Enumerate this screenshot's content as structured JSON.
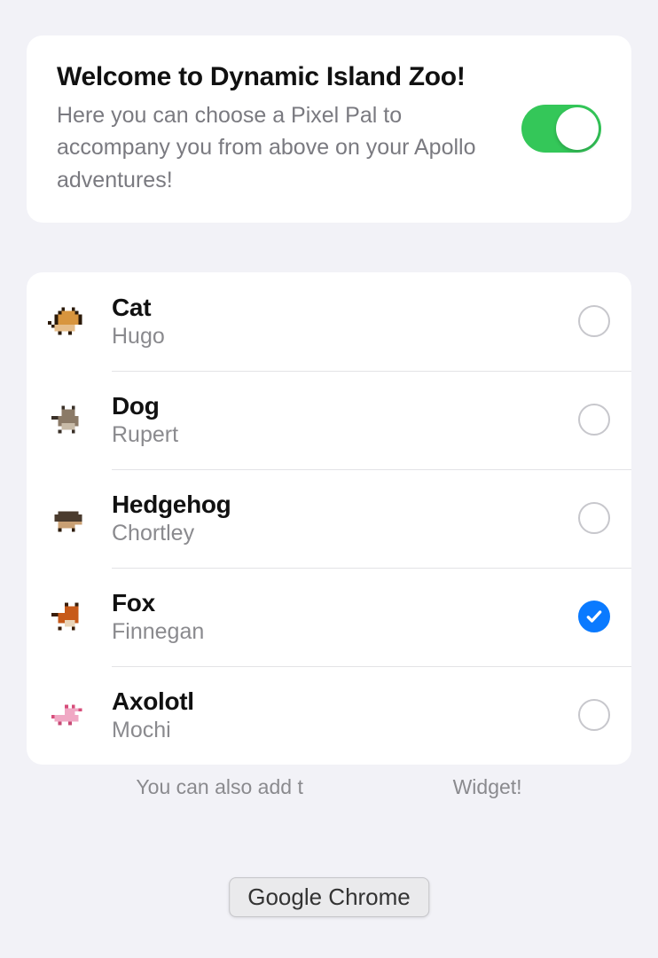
{
  "header": {
    "title": "Welcome to Dynamic Island Zoo!",
    "description": "Here you can choose a Pixel Pal to accompany you from above on your Apollo adventures!",
    "toggle_on": true
  },
  "pals": [
    {
      "species": "Cat",
      "name": "Hugo",
      "selected": false,
      "icon": "cat"
    },
    {
      "species": "Dog",
      "name": "Rupert",
      "selected": false,
      "icon": "dog"
    },
    {
      "species": "Hedgehog",
      "name": "Chortley",
      "selected": false,
      "icon": "hedgehog"
    },
    {
      "species": "Fox",
      "name": "Finnegan",
      "selected": true,
      "icon": "fox"
    },
    {
      "species": "Axolotl",
      "name": "Mochi",
      "selected": false,
      "icon": "axolotl"
    }
  ],
  "footer_text_left": "You can also add t",
  "footer_text_right": " Widget!",
  "app_switcher_label": "Google Chrome",
  "colors": {
    "accent_blue": "#0a7aff",
    "accent_green": "#34c759"
  }
}
